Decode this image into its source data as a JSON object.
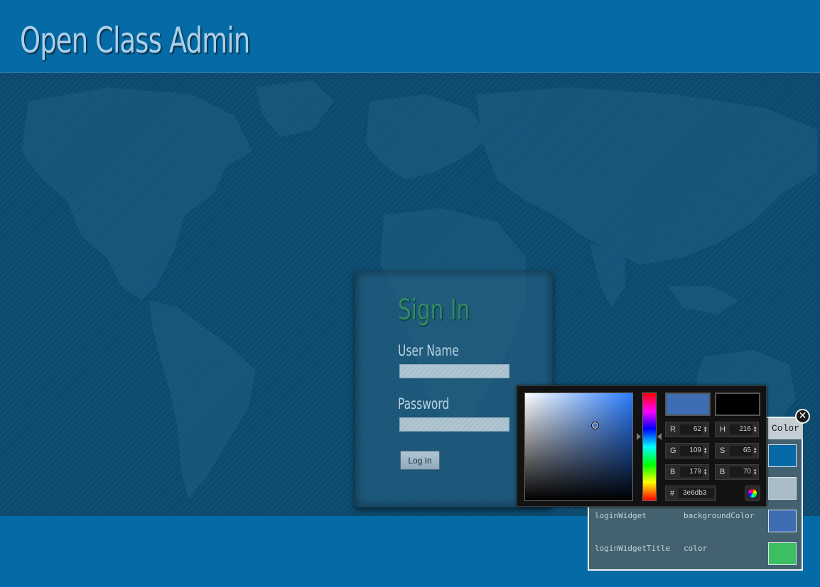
{
  "header": {
    "title": "Open Class Admin"
  },
  "login": {
    "title": "Sign In",
    "username_label": "User Name",
    "username_value": "",
    "password_label": "Password",
    "password_value": "",
    "button_label": "Log In"
  },
  "color_picker": {
    "new_color": "#3e6db3",
    "current_color": "#000000",
    "r_label": "R",
    "r_value": "62",
    "g_label": "G",
    "g_value": "109",
    "b_label": "B",
    "b_value": "179",
    "h_label": "H",
    "h_value": "216",
    "s_label": "S",
    "s_value": "65",
    "br_label": "B",
    "br_value": "70",
    "hex_label": "#",
    "hex_value": "3e6db3",
    "spinner_icon": "up-down-arrows",
    "submit_icon": "color-wheel-icon"
  },
  "style_panel": {
    "header_color": "Color",
    "close_icon": "close-icon",
    "swatches": [
      "#056aa6",
      "#a9bcc8",
      "#3e6db3",
      "#3cbf63"
    ],
    "rows": [
      {
        "element": "loginWidget",
        "property": "backgroundColor"
      },
      {
        "element": "loginWidgetTitle",
        "property": "color"
      }
    ]
  }
}
